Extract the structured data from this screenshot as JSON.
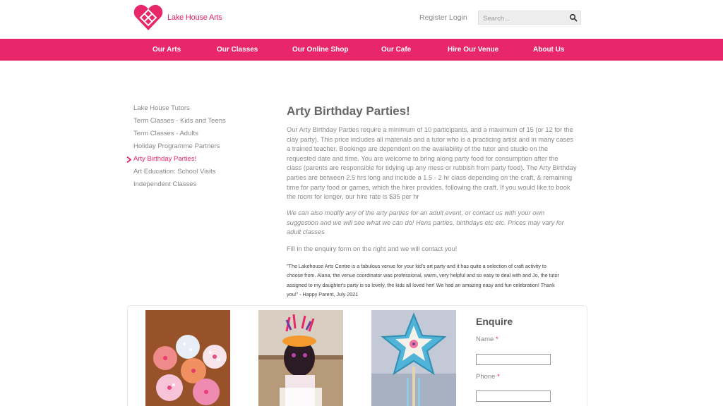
{
  "header": {
    "logo_text": "Lake House Arts",
    "register_label": "Register",
    "login_label": "Login",
    "search_placeholder": "Search...",
    "brand_color": "#e8266a",
    "search_icon": "magnifier-icon"
  },
  "nav": {
    "items": [
      "Our Arts",
      "Our Classes",
      "Our Online Shop",
      "Our Cafe",
      "Hire Our Venue",
      "About Us"
    ]
  },
  "sidebar": {
    "items": [
      "Lake House Tutors",
      "Term Classes - Kids and Teens",
      "Term Classes - Adults",
      "Holiday Programme Partners",
      "Arty Birthday Parties!",
      "Art Education: School Visits",
      "Independent Classes"
    ],
    "active_index": 4
  },
  "main": {
    "title": "Arty Birthday Parties!",
    "para1_lines": [
      "Our Arty Birthday Parties require a minimum of 10 participants, and a maximum of 15 (or 12 for the",
      "clay party). This price includes all materials and a tutor who is a practicing artist and in many cases",
      "a trained teacher. Bookings are dependent on the availability of the tutor and studio on the",
      "requested date and time. You are welcome to bring along party food for consumption after the",
      "class (parents are responsible for tidying up any mess or rubbish from party food). The Arty Birthday",
      "parties are between 2.5 hrs long and include a 1.5 - 2 hr class depending on the craft, & remaining",
      "time for party food or games, which the hirer provides, following the craft. If you would like to book",
      "the room for longer, our hire rate is $35 per hr"
    ],
    "para2_lines": [
      "We can also modify any of the arty parties for an adult event, or contact us with your own",
      "suggestion and we will see what we can do! Hens parties, birthdays etc etc. Prices may vary for",
      "adult classes"
    ],
    "para3": "Fill in the enquiry form on the right and we will contact you!",
    "quote_lines": [
      "\"The Lakehouse Arts Centre is a fabulous venue for your kid's art party and it has quite a selection of craft activity to",
      "choose from. Alana, the venue coordinator was professional, warm, very helpful and so easy to deal with and Jo, the tutor",
      "assigned to my daughter's party is so lovely, the kids all loved her! We had an amazing easy and fun celebration! Thank",
      "you!\" - Happy Parent, July 2021"
    ]
  },
  "enquire": {
    "title": "Enquire",
    "name_label": "Name",
    "phone_label": "Phone",
    "required_mark": "*"
  },
  "gallery": {
    "photos": [
      "cupcakes-photo",
      "masked-child-photo",
      "star-wand-photo"
    ]
  }
}
